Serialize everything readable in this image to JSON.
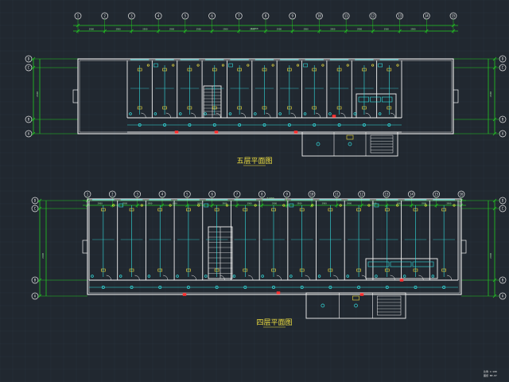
{
  "drawing": {
    "background": "#212830",
    "colors": {
      "dimension": "#22c922",
      "axis": "#e8e8e8",
      "wall": "#f2f2f2",
      "equipment": "#33e0e0",
      "fixture": "#f0e040",
      "highlight": "#ff3030",
      "grid": "#2c3440",
      "title": "#f0e040",
      "label": "#ffffff"
    },
    "plans": [
      {
        "title": "五层平面图",
        "overall_dimension": "51000",
        "left_axes": [
          "D",
          "C",
          "B",
          "A"
        ],
        "right_axes": [
          "D",
          "C",
          "B",
          "A"
        ],
        "left_dims": [
          "2400",
          "2700",
          "6000"
        ],
        "right_dims": [
          "2400",
          "2700",
          "6000"
        ],
        "bay_dims": [
          "3900",
          "3900",
          "3900",
          "3900",
          "3900",
          "3900",
          "3900",
          "3900",
          "3900",
          "3900",
          "3900",
          "3900",
          "3900"
        ],
        "bottom_dim": "2400",
        "top_axes": [
          "1",
          "2",
          "3",
          "4",
          "5",
          "6",
          "7",
          "8",
          "9",
          "10",
          "11",
          "12",
          "13",
          "14",
          "15"
        ]
      },
      {
        "title": "四层平面图",
        "overall_dimension": "51000",
        "left_axes": [
          "D",
          "C",
          "B",
          "A"
        ],
        "right_axes": [
          "D",
          "C",
          "B",
          "A"
        ],
        "left_dims": [
          "2400",
          "2700",
          "6000"
        ],
        "right_dims": [
          "2400",
          "2700",
          "6000"
        ],
        "bay_dims": [
          "3900",
          "3900",
          "3900",
          "3900",
          "3900",
          "3900",
          "3900",
          "3900",
          "3900",
          "3900",
          "3900",
          "3900",
          "3900",
          "3900",
          "3900",
          "3900"
        ],
        "bottom_dim": "2400",
        "top_axes": [
          "1",
          "2",
          "3",
          "4",
          "5",
          "6",
          "7",
          "8",
          "9",
          "10",
          "11",
          "12",
          "13",
          "14",
          "15",
          "16"
        ]
      }
    ],
    "corner_note": [
      "比例 1:100",
      "图纸 BE-07"
    ]
  }
}
